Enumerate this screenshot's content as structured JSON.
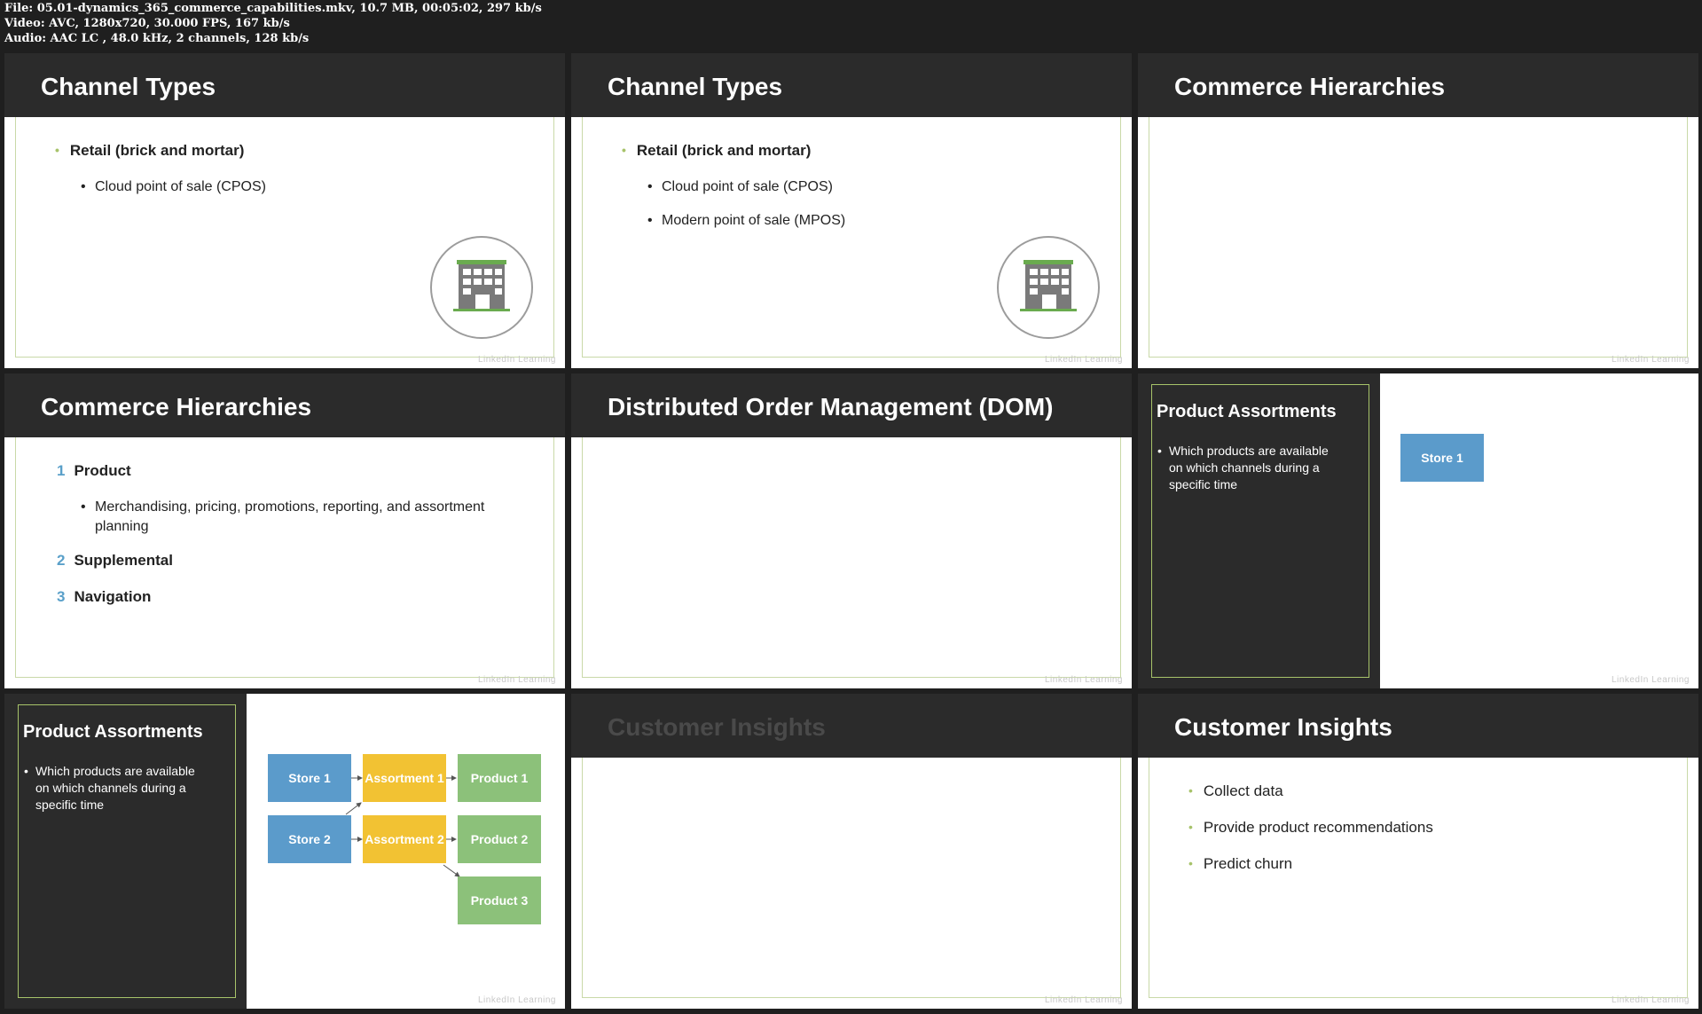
{
  "file_info": {
    "file_line": "File: 05.01-dynamics_365_commerce_capabilities.mkv, 10.7 MB, 00:05:02, 297 kb/s",
    "video_line": "Video: AVC, 1280x720, 30.000 FPS, 167 kb/s",
    "audio_line": "Audio: AAC LC , 48.0 kHz, 2 channels, 128 kb/s"
  },
  "brand": "LinkedIn Learning",
  "colors": {
    "dark_bar": "#2b2b2b",
    "green_accent": "#a7c36a",
    "number_blue": "#5aa0c9",
    "store_blue": "#5b9bcb",
    "assortment_yellow": "#f2c233",
    "product_green": "#8cc17a"
  },
  "slides": [
    {
      "title": "Channel Types",
      "bullet": "Retail (brick and mortar)",
      "subs": [
        "Cloud point of sale (CPOS)"
      ],
      "icon": "building-icon"
    },
    {
      "title": "Channel Types",
      "bullet": "Retail (brick and mortar)",
      "subs": [
        "Cloud point of sale (CPOS)",
        "Modern point of sale (MPOS)"
      ],
      "icon": "building-icon"
    },
    {
      "title": "Commerce Hierarchies"
    },
    {
      "title": "Commerce Hierarchies",
      "items": [
        {
          "num": "1",
          "label": "Product",
          "sub": "Merchandising, pricing, promotions, reporting, and assortment planning"
        },
        {
          "num": "2",
          "label": "Supplemental"
        },
        {
          "num": "3",
          "label": "Navigation"
        }
      ]
    },
    {
      "title": "Distributed Order Management (DOM)"
    },
    {
      "title": "Product Assortments",
      "desc": "Which products are available on which channels during a specific time",
      "store": "Store 1"
    },
    {
      "title": "Product Assortments",
      "desc": "Which products are available on which channels during a specific time",
      "stores": [
        "Store 1",
        "Store 2"
      ],
      "assortments": [
        "Assortment 1",
        "Assortment 2"
      ],
      "products": [
        "Product 1",
        "Product 2",
        "Product 3"
      ]
    },
    {
      "title": "Customer Insights"
    },
    {
      "title": "Customer Insights",
      "bullets": [
        "Collect data",
        "Provide product recommendations",
        "Predict churn"
      ]
    }
  ]
}
